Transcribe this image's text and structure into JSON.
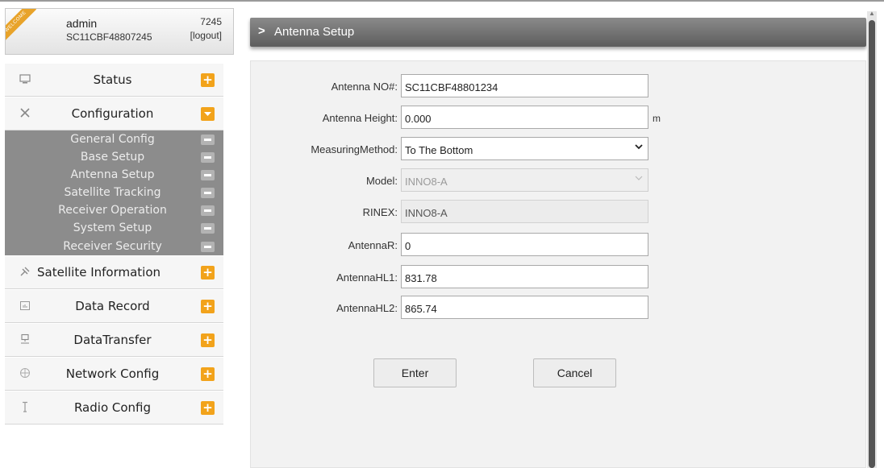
{
  "user": {
    "ribbon": "WELCOME",
    "name": "admin",
    "serial": "SC11CBF48807245",
    "number": "7245",
    "logout": "[logout]"
  },
  "menu": {
    "status": {
      "label": "Status",
      "icon": "monitor-icon",
      "toggle": "+"
    },
    "configuration": {
      "label": "Configuration",
      "icon": "tools-icon",
      "toggle": "−"
    },
    "submenu": [
      {
        "label": "General Config"
      },
      {
        "label": "Base Setup"
      },
      {
        "label": "Antenna Setup"
      },
      {
        "label": "Satellite Tracking"
      },
      {
        "label": "Receiver Operation"
      },
      {
        "label": "System Setup"
      },
      {
        "label": "Receiver Security"
      }
    ],
    "satellite_info": {
      "label": "Satellite Information",
      "icon": "satellite-icon",
      "toggle": "+"
    },
    "data_record": {
      "label": "Data Record",
      "icon": "calendar-icon",
      "toggle": "+"
    },
    "data_transfer": {
      "label": "DataTransfer",
      "icon": "network-icon",
      "toggle": "+"
    },
    "network_config": {
      "label": "Network Config",
      "icon": "globe-icon",
      "toggle": "+"
    },
    "radio_config": {
      "label": "Radio Config",
      "icon": "antenna-icon",
      "toggle": "+"
    }
  },
  "header": {
    "title": "Antenna Setup"
  },
  "form": {
    "antenna_no": {
      "label": "Antenna NO#:",
      "value": "SC11CBF48801234"
    },
    "antenna_height": {
      "label": "Antenna Height:",
      "value": "0.000",
      "unit": "m"
    },
    "measuring_method": {
      "label": "MeasuringMethod:",
      "value": "To The Bottom"
    },
    "model": {
      "label": "Model:",
      "value": "INNO8-A"
    },
    "rinex": {
      "label": "RINEX:",
      "value": "INNO8-A"
    },
    "antenna_r": {
      "label": "AntennaR:",
      "value": "0"
    },
    "antenna_hl1": {
      "label": "AntennaHL1:",
      "value": "831.78"
    },
    "antenna_hl2": {
      "label": "AntennaHL2:",
      "value": "865.74"
    }
  },
  "buttons": {
    "enter": "Enter",
    "cancel": "Cancel"
  }
}
